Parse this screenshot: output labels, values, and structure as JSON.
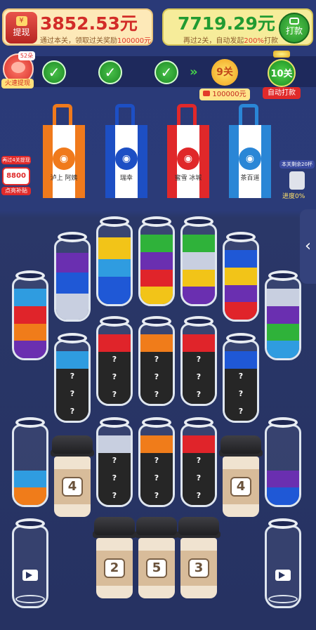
{
  "header": {
    "withdraw_label": "提现",
    "withdraw_yen": "¥",
    "withdraw_amount": "3852.53元",
    "withdraw_note_pre": "通过本关，领取过关奖励",
    "withdraw_note_num": "100000元",
    "punch_amount": "7719.29元",
    "punch_note_pre": "再过2关，自动发起",
    "punch_note_num": "200%",
    "punch_note_post": "打款",
    "punch_button": "打款"
  },
  "progress": {
    "pig_badge": "52朵",
    "pig_label": "火速提现",
    "current_level": "9关",
    "current_reward": "100000元",
    "next_level": "10关",
    "next_label": "自动打款"
  },
  "side": {
    "left_note": "再过4关提现",
    "left_amount": "8800元",
    "left_label": "点亮补贴",
    "right_note": "本关剩余20杯",
    "right_label": "进度",
    "right_pct": "0%"
  },
  "bags": [
    {
      "label": "泸上\n阿姨",
      "color": "#f07a1c"
    },
    {
      "label": "瑞幸",
      "color": "#1d4fc4"
    },
    {
      "label": "蜜雪\n冰城",
      "color": "#e0282a"
    },
    {
      "label": "茶百道",
      "color": "#2a86d6"
    }
  ],
  "bottle_question": "?",
  "cups": [
    "4",
    "4",
    "2",
    "5",
    "3"
  ],
  "colors": {
    "purple": "#6a2fb0",
    "blue": "#1f58d6",
    "lightblue": "#2f9ce0",
    "silver": "#c8cfe0",
    "yellow": "#f2c418",
    "green": "#2fb23a",
    "red": "#e0242a",
    "orange": "#f07c1a",
    "dark": "#262626"
  }
}
